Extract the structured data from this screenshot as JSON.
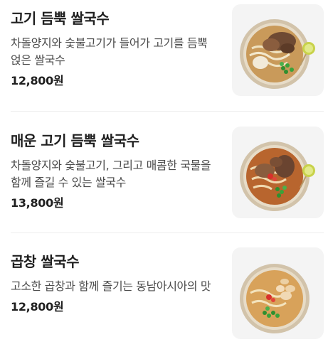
{
  "menu": {
    "items": [
      {
        "name": "고기 듬뿍 쌀국수",
        "description": "차돌양지와 숯불고기가 들어가 고기를 듬뿍 얹은 쌀국수",
        "price": "12,800원",
        "image_icon": "beef-pho-bowl"
      },
      {
        "name": "매운 고기 듬뿍 쌀국수",
        "description": "차돌양지와 숯불고기, 그리고 매콤한 국물을 함께 즐길 수 있는 쌀국수",
        "price": "13,800원",
        "image_icon": "spicy-beef-pho-bowl"
      },
      {
        "name": "곱창 쌀국수",
        "description": "고소한 곱창과 함께 즐기는 동남아시아의 맛",
        "price": "12,800원",
        "image_icon": "tripe-pho-bowl"
      }
    ]
  },
  "colors": {
    "text_primary": "#1f1f1f",
    "text_secondary": "#4b4b4b",
    "thumb_background": "#f4f4f4",
    "divider": "#eeeeee"
  }
}
